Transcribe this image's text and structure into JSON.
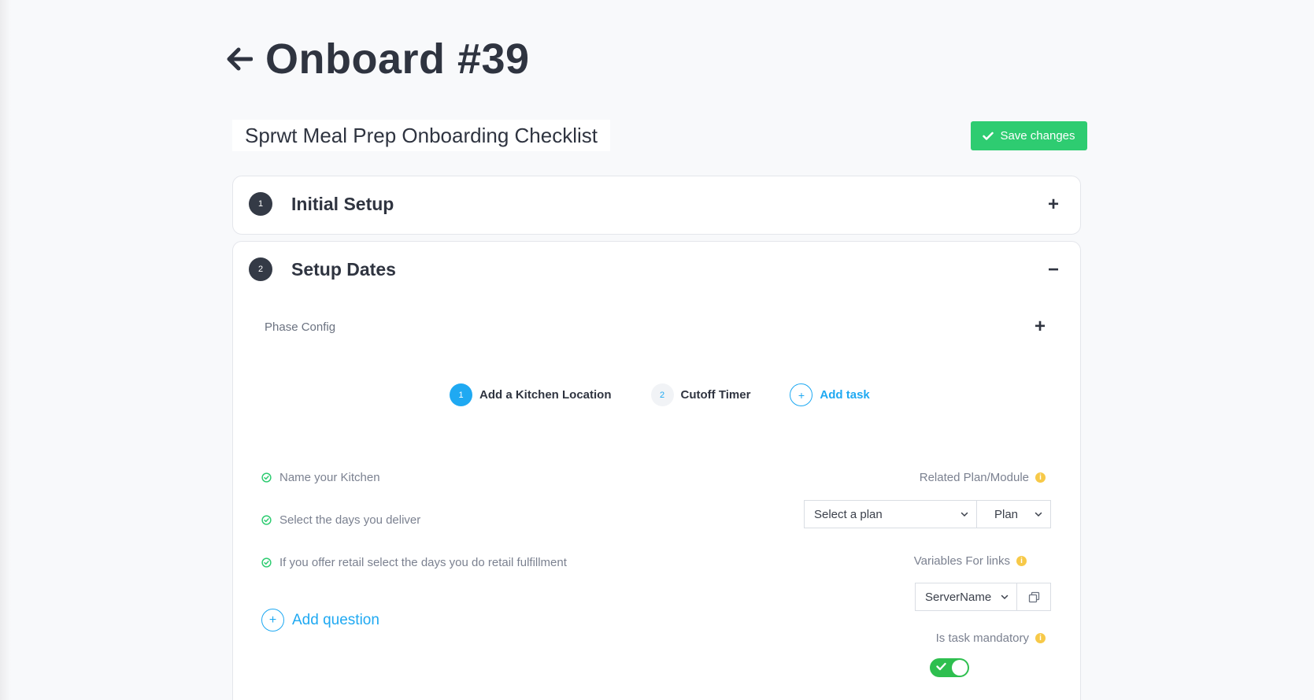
{
  "page": {
    "title": "Onboard #39",
    "checklist_name": "Sprwt Meal Prep Onboarding Checklist",
    "save_label": "Save changes"
  },
  "phases": [
    {
      "number": "1",
      "title": "Initial Setup",
      "toggle": "+",
      "expanded": false
    },
    {
      "number": "2",
      "title": "Setup Dates",
      "toggle": "−",
      "expanded": true
    }
  ],
  "phase_config": {
    "label": "Phase Config",
    "toggle": "+"
  },
  "tasks": [
    {
      "number": "1",
      "label": "Add a Kitchen Location",
      "active": true
    },
    {
      "number": "2",
      "label": "Cutoff Timer",
      "active": false
    }
  ],
  "add_task": {
    "symbol": "+",
    "label": "Add task"
  },
  "questions": [
    {
      "text": "Name your Kitchen"
    },
    {
      "text": "Select the days you deliver"
    },
    {
      "text": "If you offer retail select the days you do retail fulfillment"
    }
  ],
  "add_question": {
    "symbol": "+",
    "label": "Add question"
  },
  "related_plan": {
    "label": "Related Plan/Module",
    "plan_select": "Select a plan",
    "type_select": "Plan"
  },
  "variables": {
    "label": "Variables For links",
    "select": "ServerName"
  },
  "mandatory": {
    "label": "Is task mandatory",
    "on": true
  },
  "info_glyph": "i",
  "colors": {
    "accent": "#1fa9f2",
    "success": "#2ecc71",
    "toggle_on": "#2ebf4f",
    "info": "#f7c948",
    "dark": "#343a46"
  }
}
